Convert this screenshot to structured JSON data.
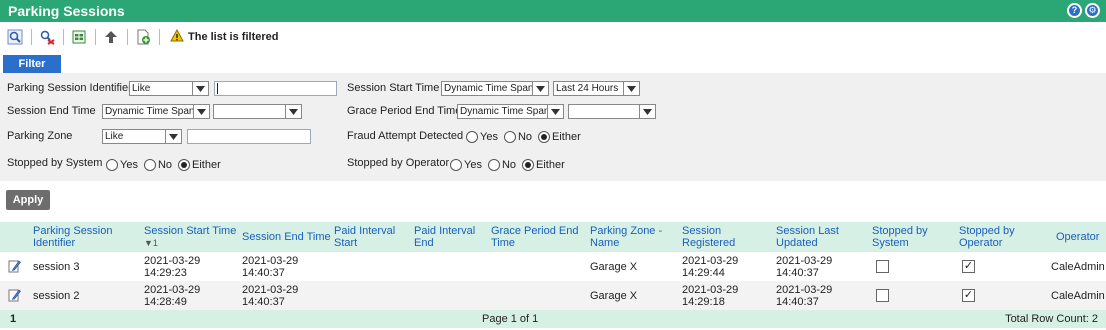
{
  "title": "Parking Sessions",
  "title_icons": [
    "help-icon",
    "settings-icon"
  ],
  "toolbar": {
    "buttons": [
      "search-icon",
      "clear-filter-icon",
      "export-icon",
      "back-icon",
      "new-document-icon"
    ],
    "filtered_note": "The list is filtered"
  },
  "filter_tab": "Filter",
  "filters": {
    "parking_session_identifier": {
      "label": "Parking Session Identifier",
      "op": "Like",
      "value": ""
    },
    "session_start_time": {
      "label": "Session Start Time",
      "mode": "Dynamic Time Span",
      "range": "Last 24 Hours"
    },
    "session_end_time": {
      "label": "Session End Time",
      "mode": "Dynamic Time Span",
      "range": ""
    },
    "grace_period_end_time": {
      "label": "Grace Period End Time",
      "mode": "Dynamic Time Span",
      "range": ""
    },
    "parking_zone": {
      "label": "Parking Zone",
      "op": "Like",
      "value": ""
    },
    "fraud_attempt_detected": {
      "label": "Fraud Attempt Detected",
      "selected": "Either"
    },
    "stopped_by_system": {
      "label": "Stopped by System",
      "selected": "Either"
    },
    "stopped_by_operator": {
      "label": "Stopped by Operator",
      "selected": "Either"
    },
    "options": {
      "yes": "Yes",
      "no": "No",
      "either": "Either"
    }
  },
  "apply_label": "Apply",
  "columns": {
    "id": "Parking Session Identifier",
    "start": "Session Start Time",
    "sort_indicator": "▼1",
    "end": "Session End Time",
    "paid_start": "Paid Interval Start",
    "paid_end": "Paid Interval End",
    "grace": "Grace Period End Time",
    "zone": "Parking Zone - Name",
    "registered": "Session Registered",
    "updated": "Session Last Updated",
    "sys": "Stopped by System",
    "op": "Stopped by Operator",
    "operator": "Operator"
  },
  "rows": [
    {
      "id": "session 3",
      "start_date": "2021-03-29",
      "start_time": "14:29:23",
      "end_date": "2021-03-29",
      "end_time": "14:40:37",
      "zone": "Garage X",
      "reg_date": "2021-03-29",
      "reg_time": "14:29:44",
      "upd_date": "2021-03-29",
      "upd_time": "14:40:37",
      "stopped_by_system": false,
      "stopped_by_operator": true,
      "operator": "CaleAdmin"
    },
    {
      "id": "session 2",
      "start_date": "2021-03-29",
      "start_time": "14:28:49",
      "end_date": "2021-03-29",
      "end_time": "14:40:37",
      "zone": "Garage X",
      "reg_date": "2021-03-29",
      "reg_time": "14:29:18",
      "upd_date": "2021-03-29",
      "upd_time": "14:40:37",
      "stopped_by_system": false,
      "stopped_by_operator": true,
      "operator": "CaleAdmin"
    }
  ],
  "footer": {
    "page_number": "1",
    "page_info": "Page 1 of 1",
    "total": "Total Row Count: 2"
  },
  "colors": {
    "title_bar": "#2aa775",
    "accent": "#2a6fcc",
    "header_bg": "#d7f0e6",
    "header_text": "#1a5fb8"
  }
}
